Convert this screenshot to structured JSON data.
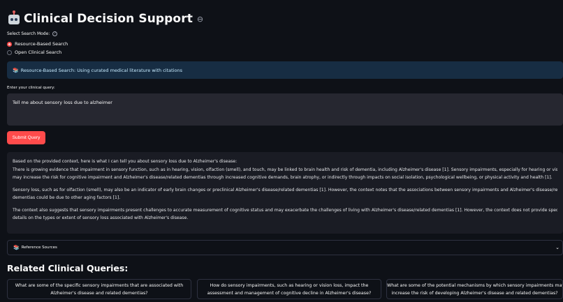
{
  "header": {
    "title": "Clinical Decision Support",
    "icon": "robot-icon"
  },
  "search_mode": {
    "label": "Select Search Mode:",
    "options": [
      {
        "label": "Resource-Based Search",
        "selected": true
      },
      {
        "label": "Open Clinical Search",
        "selected": false
      }
    ]
  },
  "info": {
    "text": "Resource-Based Search: Using curated medical literature with citations"
  },
  "query": {
    "label": "Enter your clinical query:",
    "value": "Tell me about sensory loss due to alzheimer"
  },
  "submit_label": "Submit Query",
  "answer": {
    "p1_line1": "Based on the provided context, here is what I can tell you about sensory loss due to Alzheimer's disease:",
    "p1_line2": "There is growing evidence that impairment in sensory function, such as in hearing, vision, olfaction (smell), and touch, may be linked to brain health and risk of dementia, including Alzheimer's disease [1]. Sensory impairments, especially for hearing or vision,",
    "p1_line3": "may increase the risk for cognitive impairment and Alzheimer's disease/related dementias through increased cognitive demands, brain atrophy, or indirectly through impacts on social isolation, psychological wellbeing, or physical activity and health [1].",
    "p2_line1": "Sensory loss, such as for olfaction (smell), may also be an indicator of early brain changes or preclinical Alzheimer's disease/related dementias [1]. However, the context notes that the associations between sensory impairments and Alzheimer's disease/related",
    "p2_line2": "dementias could be due to other aging factors [1].",
    "p3_line1": "The context also suggests that sensory impairments present challenges to accurate measurement of cognitive status and may exacerbate the challenges of living with Alzheimer's disease/related dementias [1]. However, the context does not provide specific",
    "p3_line2": "details on the types or extent of sensory loss associated with Alzheimer's disease."
  },
  "sources": {
    "label": "Reference Sources"
  },
  "related": {
    "title": "Related Clinical Queries:",
    "cards": [
      {
        "line1": "What are some of the specific sensory impairments that are associated with",
        "line2": "Alzheimer's disease and related dementias?"
      },
      {
        "line1": "How do sensory impairments, such as hearing or vision loss, impact the",
        "line2": "assessment and management of cognitive decline in Alzheimer's disease?"
      },
      {
        "line1": "What are some of the potential mechanisms by which sensory impairments may",
        "line2": "increase the risk of developing Alzheimer's disease and related dementias?"
      }
    ]
  }
}
